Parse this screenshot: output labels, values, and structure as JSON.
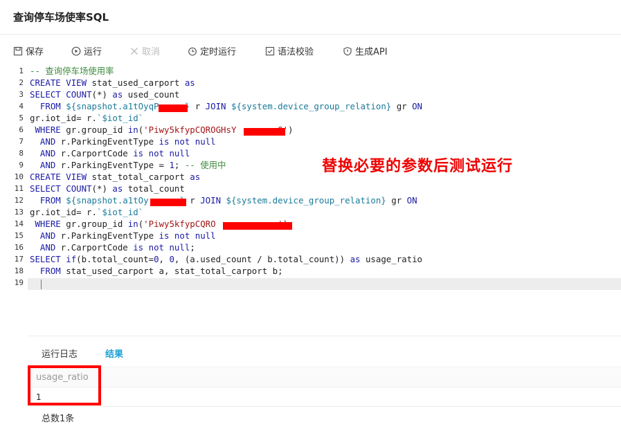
{
  "title": "查询停车场使率SQL",
  "toolbar": {
    "save": "保存",
    "run": "运行",
    "cancel": "取消",
    "schedule": "定时运行",
    "syntax_check": "语法校验",
    "gen_api": "生成API"
  },
  "editor": {
    "line_numbers": [
      "1",
      "2",
      "3",
      "4",
      "5",
      "6",
      "7",
      "8",
      "9",
      "10",
      "11",
      "12",
      "13",
      "14",
      "15",
      "16",
      "17",
      "18",
      "19"
    ],
    "lines": [
      "-- 查询停车场使用率",
      "CREATE VIEW stat_used_carport as",
      "SELECT COUNT(*) as used_count",
      "  FROM ${snapshot.a1tOyqP     } r JOIN ${system.device_group_relation} gr ON",
      "gr.iot_id= r.`$iot_id`",
      " WHERE gr.group_id in('Piwy5kfypCQROGHsY        0')",
      "  AND r.ParkingEventType is not null",
      "  AND r.CarportCode is not null",
      "  AND r.ParkingEventType = 1; -- 使用中",
      "CREATE VIEW stat_total_carport as",
      "SELECT COUNT(*) as total_count",
      "  FROM ${snapshot.a1tOy      } r JOIN ${system.device_group_relation} gr ON",
      "gr.iot_id= r.`$iot_id`",
      " WHERE gr.group_id in('Piwy5kfypCQRO            ')",
      "  AND r.ParkingEventType is not null",
      "  AND r.CarportCode is not null;",
      "SELECT if(b.total_count=0, 0, (a.used_count / b.total_count)) as usage_ratio",
      "  FROM stat_used_carport a, stat_total_carport b;",
      ""
    ]
  },
  "annotation": "替换必要的参数后测试运行",
  "tabs": {
    "log": "运行日志",
    "result": "结果"
  },
  "result": {
    "column": "usage_ratio",
    "value": "1",
    "total": "总数1条"
  },
  "colors": {
    "accent": "#1aa0d6",
    "highlight": "#ff0000"
  },
  "icons": [
    "save-icon",
    "play-icon",
    "close-icon",
    "clock-icon",
    "check-icon",
    "api-icon"
  ]
}
